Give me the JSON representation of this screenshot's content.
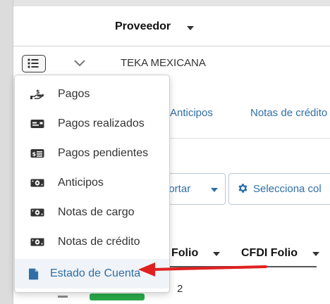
{
  "header": {
    "title": "Proveedor"
  },
  "supplier": {
    "name": "TEKA MEXICANA"
  },
  "tabs": [
    {
      "label": "Anticipos"
    },
    {
      "label": "Notas de crédito"
    }
  ],
  "toolbar": {
    "export_label": "portar",
    "columns_label": "Selecciona col"
  },
  "table": {
    "columns": [
      {
        "label": "Folio"
      },
      {
        "label": "CFDI Folio"
      }
    ],
    "first_row_value": "2"
  },
  "menu": {
    "items": [
      {
        "label": "Pagos",
        "icon": "hand-dollar-icon"
      },
      {
        "label": "Pagos realizados",
        "icon": "card-icon"
      },
      {
        "label": "Pagos pendientes",
        "icon": "list-card-icon"
      },
      {
        "label": "Anticipos",
        "icon": "money-bill-icon"
      },
      {
        "label": "Notas de cargo",
        "icon": "money-bill-icon"
      },
      {
        "label": "Notas de crédito",
        "icon": "money-bill-icon"
      },
      {
        "label": "Estado de Cuenta",
        "icon": "file-icon"
      }
    ]
  },
  "colors": {
    "link": "#2f6fa6",
    "arrow": "#e02020",
    "badge": "#2aa84a"
  }
}
